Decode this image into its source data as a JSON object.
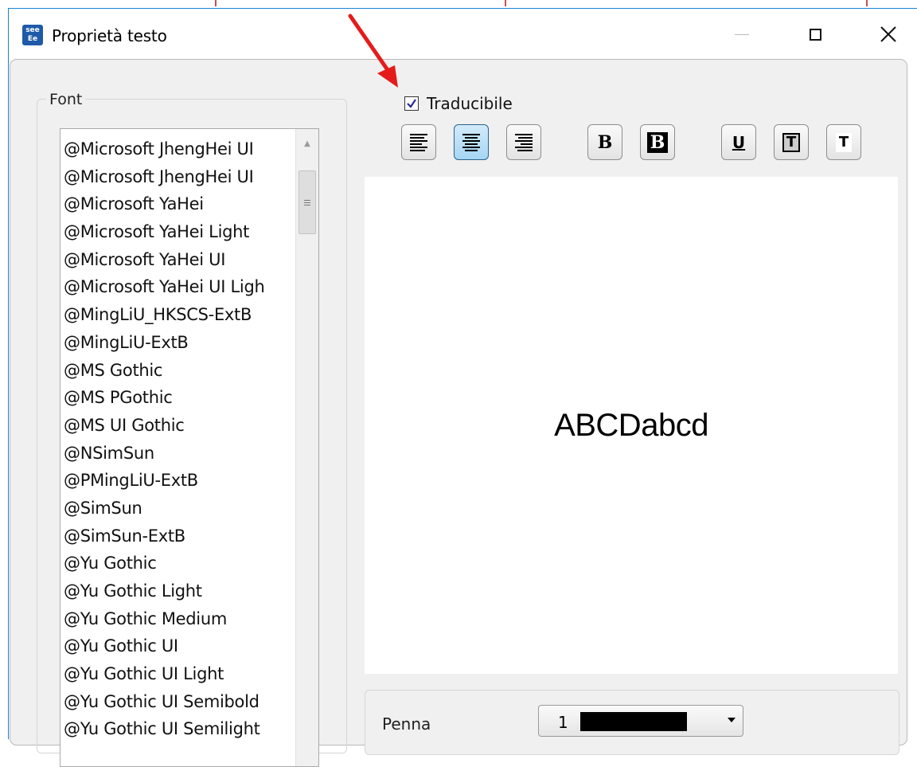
{
  "window": {
    "title": "Proprietà testo"
  },
  "font_group": {
    "legend": "Font",
    "items": [
      "@Microsoft JhengHei UI",
      "@Microsoft JhengHei UI",
      "@Microsoft YaHei",
      "@Microsoft YaHei Light",
      "@Microsoft YaHei UI",
      "@Microsoft YaHei UI Ligh",
      "@MingLiU_HKSCS-ExtB",
      "@MingLiU-ExtB",
      "@MS Gothic",
      "@MS PGothic",
      "@MS UI Gothic",
      "@NSimSun",
      "@PMingLiU-ExtB",
      "@SimSun",
      "@SimSun-ExtB",
      "@Yu Gothic",
      "@Yu Gothic Light",
      "@Yu Gothic Medium",
      "@Yu Gothic UI",
      "@Yu Gothic UI Light",
      "@Yu Gothic UI Semibold",
      "@Yu Gothic UI Semilight"
    ]
  },
  "translatable": {
    "label": "Traducibile",
    "checked": true
  },
  "toolbar": {
    "bold_glyph": "B",
    "bold_boxed_glyph": "B",
    "underline_glyph": "U",
    "text_boxed_glyph": "T",
    "text_plain_glyph": "T"
  },
  "preview": {
    "sample": "ABCDabcd"
  },
  "pen": {
    "label": "Penna",
    "value": "1",
    "color": "#000000"
  },
  "colors": {
    "window_border": "#1883d7",
    "active_button": "#a6d6f4",
    "arrow": "#e51b1b"
  }
}
